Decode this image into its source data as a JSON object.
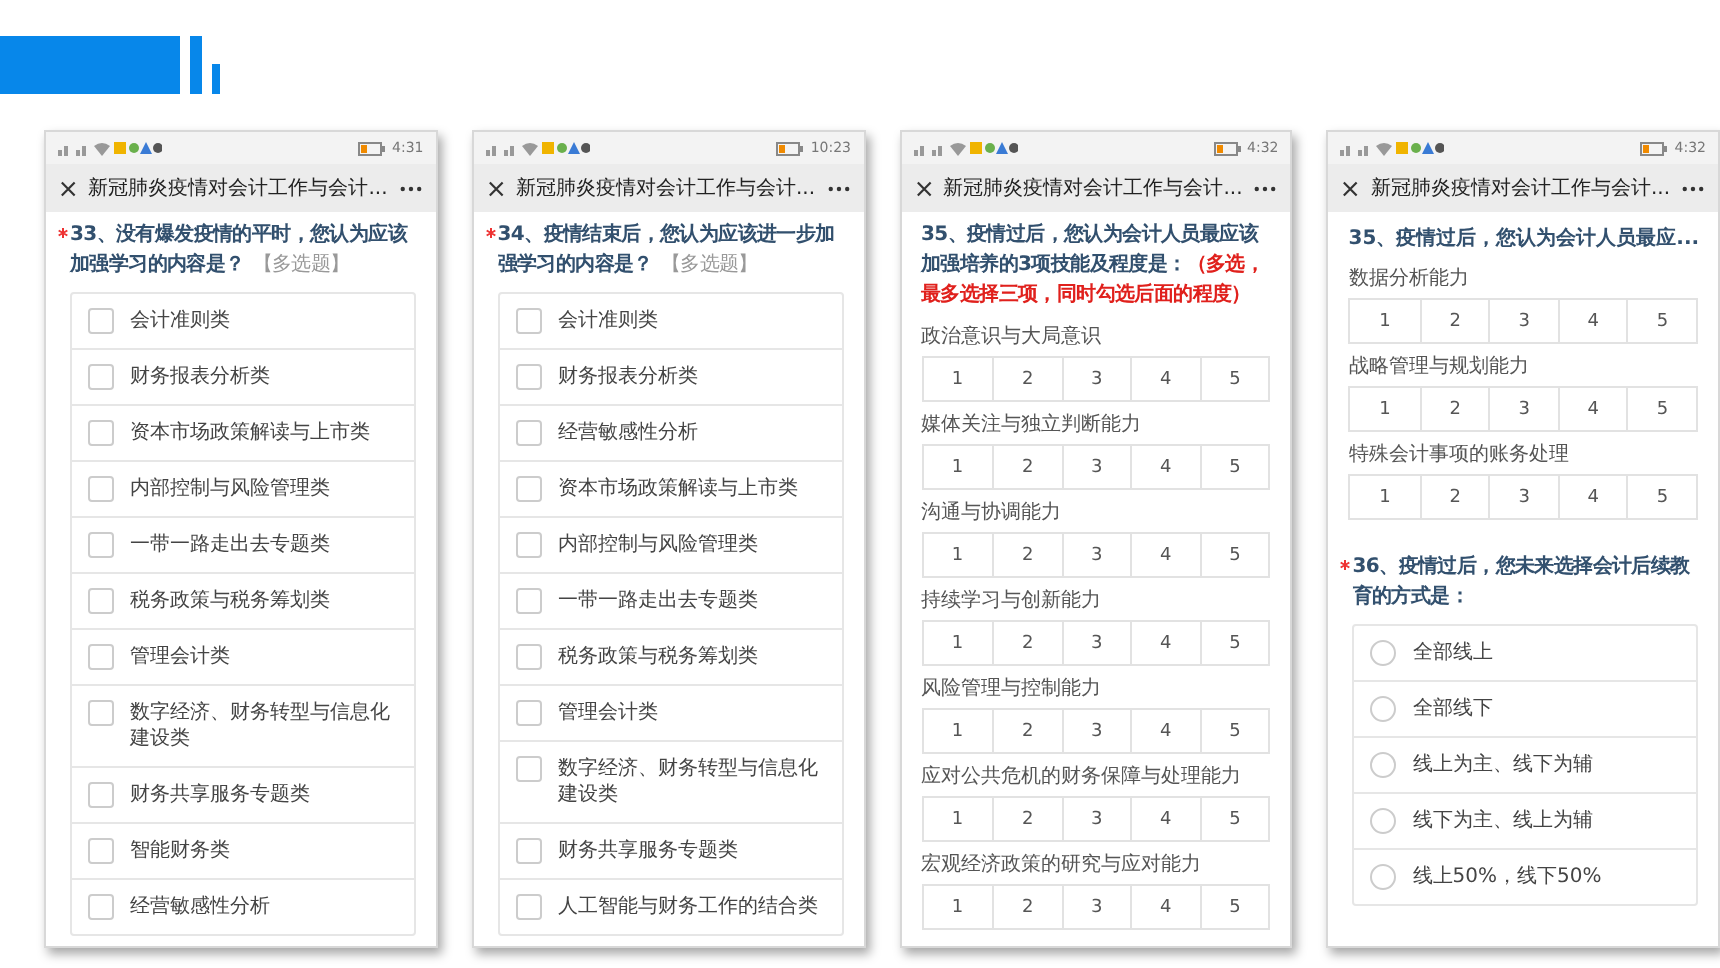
{
  "phones": [
    {
      "status_time": "4:31",
      "title": "新冠肺炎疫情对会计工作与会计...",
      "blocks": [
        {
          "kind": "question",
          "required": true,
          "text": "33、没有爆发疫情的平时，您认为应该加强学习的内容是？",
          "tag": "【多选题】"
        },
        {
          "kind": "checkboxes",
          "items": [
            {
              "label": "会计准则类",
              "checked": false
            },
            {
              "label": "财务报表分析类",
              "checked": false
            },
            {
              "label": "资本市场政策解读与上市类",
              "checked": false
            },
            {
              "label": "内部控制与风险管理类",
              "checked": false
            },
            {
              "label": "一带一路走出去专题类",
              "checked": false
            },
            {
              "label": "税务政策与税务筹划类",
              "checked": false
            },
            {
              "label": "管理会计类",
              "checked": false
            },
            {
              "label": "数字经济、财务转型与信息化建设类",
              "checked": false
            },
            {
              "label": "财务共享服务专题类",
              "checked": false
            },
            {
              "label": "智能财务类",
              "checked": false
            },
            {
              "label": "经营敏感性分析",
              "checked": false
            }
          ]
        }
      ]
    },
    {
      "status_time": "10:23",
      "title": "新冠肺炎疫情对会计工作与会计...",
      "blocks": [
        {
          "kind": "question",
          "required": true,
          "text": "34、疫情结束后，您认为应该进一步加强学习的内容是？",
          "tag": "【多选题】"
        },
        {
          "kind": "checkboxes",
          "items": [
            {
              "label": "会计准则类",
              "checked": false
            },
            {
              "label": "财务报表分析类",
              "checked": false
            },
            {
              "label": "经营敏感性分析",
              "checked": false
            },
            {
              "label": "资本市场政策解读与上市类",
              "checked": false
            },
            {
              "label": "内部控制与风险管理类",
              "checked": false
            },
            {
              "label": "一带一路走出去专题类",
              "checked": false
            },
            {
              "label": "税务政策与税务筹划类",
              "checked": false
            },
            {
              "label": "管理会计类",
              "checked": false
            },
            {
              "label": "数字经济、财务转型与信息化建设类",
              "checked": false
            },
            {
              "label": "财务共享服务专题类",
              "checked": false
            },
            {
              "label": "人工智能与财务工作的结合类",
              "checked": false
            }
          ]
        }
      ]
    },
    {
      "status_time": "4:32",
      "title": "新冠肺炎疫情对会计工作与会计...",
      "blocks": [
        {
          "kind": "question",
          "required": false,
          "text": "35、疫情过后，您认为会计人员最应该加强培养的3项技能及程度是：",
          "note": "（多选，最多选择三项，同时勾选后面的程度）"
        },
        {
          "kind": "scales",
          "items": [
            {
              "label": "政治意识与大局意识",
              "options": [
                "1",
                "2",
                "3",
                "4",
                "5"
              ]
            },
            {
              "label": "媒体关注与独立判断能力",
              "options": [
                "1",
                "2",
                "3",
                "4",
                "5"
              ]
            },
            {
              "label": "沟通与协调能力",
              "options": [
                "1",
                "2",
                "3",
                "4",
                "5"
              ]
            },
            {
              "label": "持续学习与创新能力",
              "options": [
                "1",
                "2",
                "3",
                "4",
                "5"
              ]
            },
            {
              "label": "风险管理与控制能力",
              "options": [
                "1",
                "2",
                "3",
                "4",
                "5"
              ]
            },
            {
              "label": "应对公共危机的财务保障与处理能力",
              "options": [
                "1",
                "2",
                "3",
                "4",
                "5"
              ]
            },
            {
              "label": "宏观经济政策的研究与应对能力",
              "options": [
                "1",
                "2",
                "3",
                "4",
                "5"
              ]
            }
          ]
        }
      ]
    },
    {
      "status_time": "4:32",
      "title": "新冠肺炎疫情对会计工作与会计...",
      "blocks": [
        {
          "kind": "pinned",
          "text": "35、疫情过后，您认为会计人员最应..."
        },
        {
          "kind": "scales",
          "items": [
            {
              "label": "数据分析能力",
              "options": [
                "1",
                "2",
                "3",
                "4",
                "5"
              ]
            },
            {
              "label": "战略管理与规划能力",
              "options": [
                "1",
                "2",
                "3",
                "4",
                "5"
              ]
            },
            {
              "label": "特殊会计事项的账务处理",
              "options": [
                "1",
                "2",
                "3",
                "4",
                "5"
              ]
            }
          ]
        },
        {
          "kind": "question",
          "required": true,
          "text": "36、疫情过后，您未来选择会计后续教育的方式是："
        },
        {
          "kind": "radios",
          "items": [
            {
              "label": "全部线上",
              "selected": false
            },
            {
              "label": "全部线下",
              "selected": false
            },
            {
              "label": "线上为主、线下为辅",
              "selected": false
            },
            {
              "label": "线下为主、线上为辅",
              "selected": false
            },
            {
              "label": "线上50%，线下50%",
              "selected": false
            }
          ]
        }
      ]
    }
  ]
}
